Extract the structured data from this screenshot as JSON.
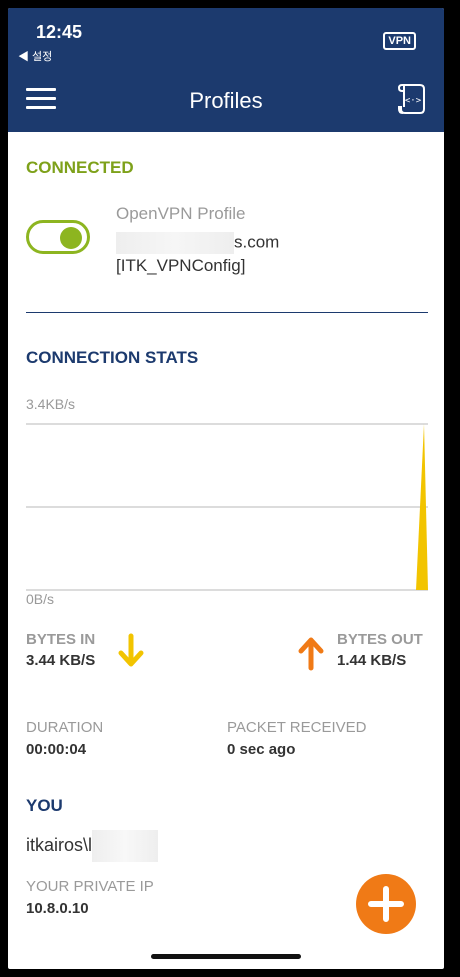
{
  "status_bar": {
    "time": "12:45",
    "back_label": "◀ 설정",
    "vpn_badge": "VPN"
  },
  "header": {
    "title": "Profiles",
    "menu_icon": "hamburger-menu-icon",
    "log_icon": "log-file-icon"
  },
  "connected": {
    "title": "CONNECTED",
    "toggle_on": true,
    "profile_name": "OpenVPN Profile",
    "server_suffix": "s.com",
    "config_label": "[ITK_VPNConfig]"
  },
  "stats": {
    "title": "CONNECTION STATS",
    "chart_max_label": "3.4KB/s",
    "chart_min_label": "0B/s",
    "bytes_in_label": "BYTES IN",
    "bytes_in_value": "3.44 KB/S",
    "bytes_out_label": "BYTES OUT",
    "bytes_out_value": "1.44 KB/S",
    "duration_label": "DURATION",
    "duration_value": "00:00:04",
    "packet_label": "PACKET RECEIVED",
    "packet_value": "0 sec ago"
  },
  "chart_data": {
    "type": "area",
    "ylim": [
      0,
      3.4
    ],
    "yunit": "KB/s",
    "series": [
      {
        "values": [
          0,
          0,
          0,
          0,
          0,
          0,
          0,
          0,
          0,
          3.44
        ]
      }
    ],
    "colors": {
      "bytes_in": "#f2c400"
    }
  },
  "you": {
    "title": "YOU",
    "username_prefix": "itkairos\\l",
    "private_ip_label": "YOUR PRIVATE IP",
    "private_ip_value": "10.8.0.10"
  },
  "fab": {
    "icon": "plus-icon"
  },
  "colors": {
    "header": "#1c3a6e",
    "connected_green": "#8db520",
    "orange": "#f07a16",
    "yellow": "#f2c400"
  }
}
